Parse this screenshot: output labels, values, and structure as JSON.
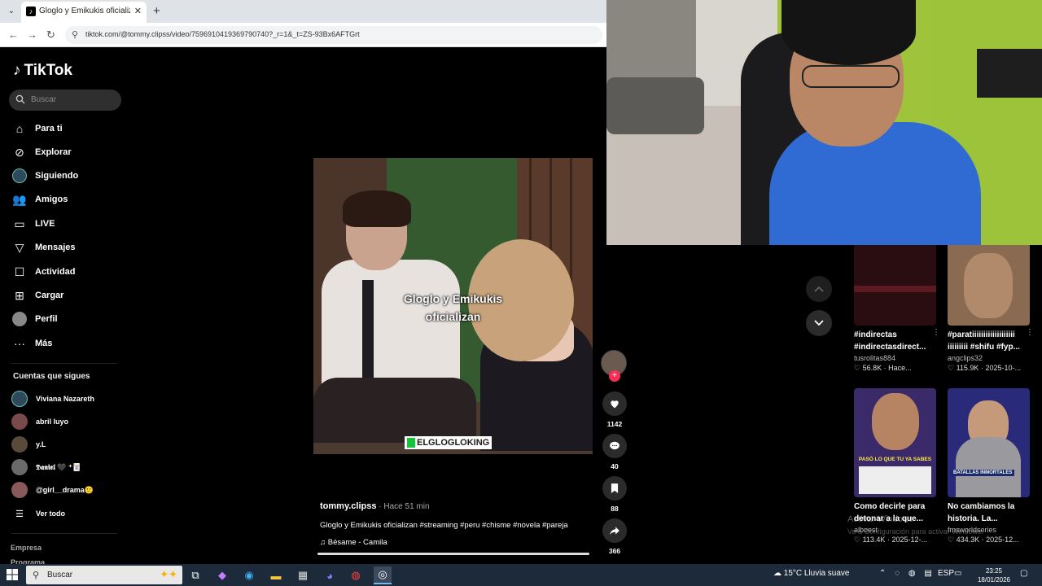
{
  "browser": {
    "tab_title": "Gloglo y Emikukis oficializan #...",
    "url": "tiktok.com/@tommy.clipss/video/7596910419369790740?_r=1&_t=ZS-93Bx6AFTGrt"
  },
  "tiktok": {
    "logo_text": "TikTok",
    "search_placeholder": "Buscar",
    "nav": [
      {
        "label": "Para ti"
      },
      {
        "label": "Explorar"
      },
      {
        "label": "Siguiendo"
      },
      {
        "label": "Amigos"
      },
      {
        "label": "LIVE"
      },
      {
        "label": "Mensajes"
      },
      {
        "label": "Actividad"
      },
      {
        "label": "Cargar"
      },
      {
        "label": "Perfil"
      },
      {
        "label": "Más"
      }
    ],
    "following_title": "Cuentas que sigues",
    "following": [
      {
        "name": "Viviana Nazareth"
      },
      {
        "name": "abril luyo"
      },
      {
        "name": "y.L"
      },
      {
        "name": "𝕯𝖆𝖓𝖎𝖊𝖑 🖤 ⁺🃏"
      },
      {
        "name": "@girl__drama🙂"
      }
    ],
    "see_all": "Ver todo",
    "footer": [
      "Empresa",
      "Programa"
    ]
  },
  "video": {
    "caption_line1": "Gloglo y Emikukis",
    "caption_line2": "oficializan",
    "watermark": "ELGLOGLOKING",
    "author": "tommy.clipss",
    "time": " · Hace 51 min",
    "description": "Gloglo y Emikukis oficializan #streaming #peru #chisme #novela #pareja",
    "music": "Bésame - Camila",
    "progress": 1.0,
    "likes": "1142",
    "comments": "40",
    "saves": "88",
    "shares": "366"
  },
  "recommended": [
    {
      "title": "#indirectas #indirectasdirect...",
      "user": "tusrolitas884",
      "views": "56.8K",
      "date": "Hace..."
    },
    {
      "title": "#paratiiiiiiiiiiiiiiiiiii iiiiiiiii #shifu #fyp...",
      "user": "angclips32",
      "views": "115.9K",
      "date": "2025-10-..."
    },
    {
      "title": "Como decirle para detonar a la que...",
      "user": "alboest",
      "views": "113.4K",
      "date": "2025-12-...",
      "overlay": "PASÓ LO QUE TU YA SABES"
    },
    {
      "title": "No cambiamos la historia. La...",
      "user": "fmsworldseries",
      "views": "434.3K",
      "date": "2025-12...",
      "overlay": "BATALLAS INMORTALES"
    }
  ],
  "windows_activate": {
    "title": "Activar Windows",
    "subtitle": "Ve a Configuración para activar Windows."
  },
  "taskbar": {
    "search_text": "Buscar",
    "weather": "15°C  Lluvia suave",
    "lang": "ESP",
    "time": "23:25",
    "date": "18/01/2026"
  },
  "colors": {
    "accent": "#fe2c55",
    "bg": "#000000"
  }
}
